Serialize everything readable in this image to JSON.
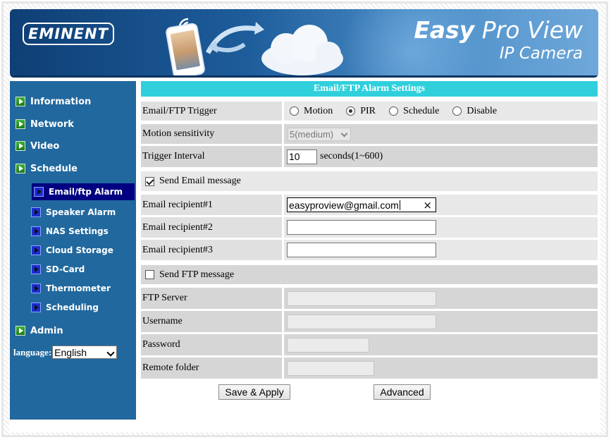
{
  "header": {
    "logo_text": "EMINENT",
    "brand_line1_bold": "Easy",
    "brand_line1_rest": " Pro View",
    "brand_line2": "IP Camera"
  },
  "sidebar": {
    "items": [
      {
        "label": "Information"
      },
      {
        "label": "Network"
      },
      {
        "label": "Video"
      },
      {
        "label": "Schedule"
      }
    ],
    "sub_items": [
      {
        "label": "Email/ftp Alarm",
        "active": true
      },
      {
        "label": "Speaker Alarm"
      },
      {
        "label": "NAS Settings"
      },
      {
        "label": "Cloud Storage"
      },
      {
        "label": "SD-Card"
      },
      {
        "label": "Thermometer"
      },
      {
        "label": "Scheduling"
      }
    ],
    "admin_label": "Admin",
    "language_label": "language:",
    "language_value": "English"
  },
  "form": {
    "title": "Email/FTP Alarm Settings",
    "trigger_label": "Email/FTP Trigger",
    "trigger_options": [
      "Motion",
      "PIR",
      "Schedule",
      "Disable"
    ],
    "trigger_selected": "PIR",
    "motion_sensitivity_label": "Motion sensitivity",
    "motion_sensitivity_value": "5(medium)",
    "trigger_interval_label": "Trigger Interval",
    "trigger_interval_value": "10",
    "trigger_interval_unit": "seconds(1~600)",
    "send_email_label": "Send Email message",
    "send_email_checked": true,
    "recipient1_label": "Email recipient#1",
    "recipient1_value": "easyproview@gmail.com",
    "recipient2_label": "Email recipient#2",
    "recipient2_value": "",
    "recipient3_label": "Email recipient#3",
    "recipient3_value": "",
    "send_ftp_label": "Send FTP message",
    "send_ftp_checked": false,
    "ftp_server_label": "FTP Server",
    "username_label": "Username",
    "password_label": "Password",
    "remote_folder_label": "Remote folder",
    "save_button": "Save & Apply",
    "advanced_button": "Advanced"
  },
  "colors": {
    "sidebar_bg": "#21689e",
    "title_bar": "#2fd0dc",
    "active_nav": "#000080"
  }
}
